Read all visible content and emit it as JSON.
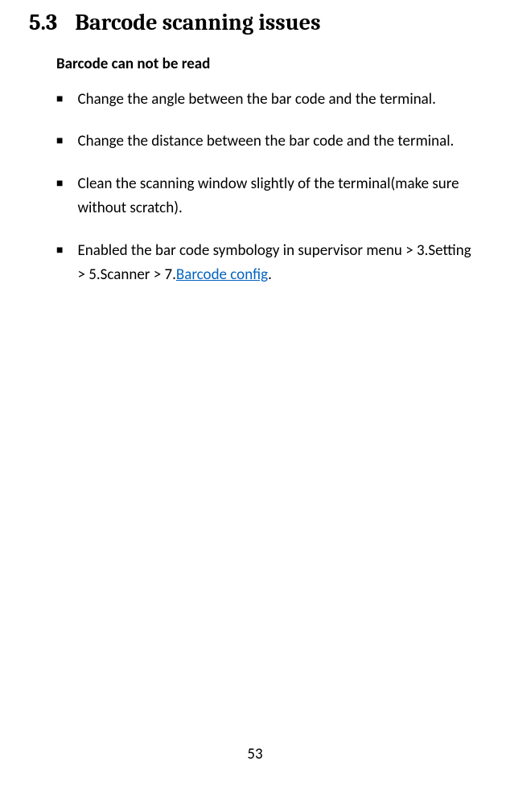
{
  "section": {
    "number": "5.3",
    "title": "Barcode scanning issues"
  },
  "subtitle": "Barcode can not be read",
  "bullets": [
    {
      "text": "Change the angle between the bar code and the terminal."
    },
    {
      "text": "Change the distance between the bar code and the terminal."
    },
    {
      "text": "Clean the scanning window slightly of the terminal(make sure without scratch)."
    },
    {
      "prefix": "Enabled the bar code symbology in supervisor menu > 3.Setting > 5.Scanner > 7.",
      "link": "Barcode config",
      "suffix": "."
    }
  ],
  "pageNumber": "53"
}
